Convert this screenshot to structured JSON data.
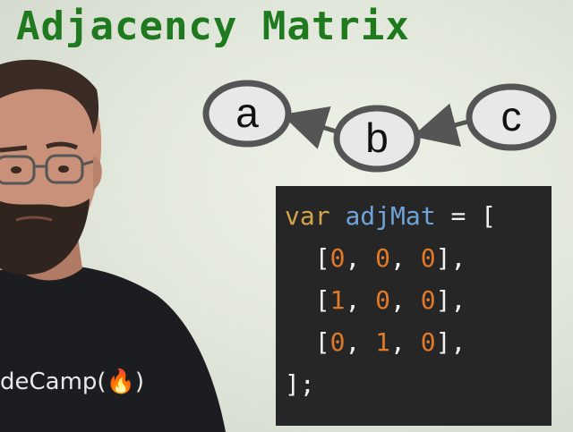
{
  "title": "Adjacency Matrix",
  "graph": {
    "nodes": [
      "a",
      "b",
      "c"
    ],
    "edges": [
      {
        "from": "b",
        "to": "a"
      },
      {
        "from": "c",
        "to": "b"
      }
    ]
  },
  "code": {
    "keyword": "var",
    "identifier": "adjMat",
    "assign": "= [",
    "rows": [
      [
        "0",
        "0",
        "0"
      ],
      [
        "1",
        "0",
        "0"
      ],
      [
        "0",
        "1",
        "0"
      ]
    ],
    "closing": "];"
  },
  "shirt_text": "deCamp(🔥)",
  "colors": {
    "title": "#1f7a1f",
    "code_bg": "#262626",
    "keyword": "#d4a34a",
    "identifier": "#6fa3d8",
    "number": "#e07a2a"
  }
}
